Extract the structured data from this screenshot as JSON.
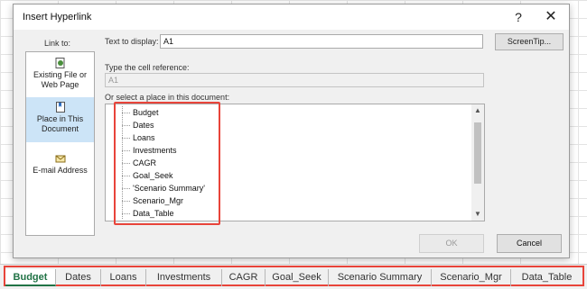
{
  "dialog": {
    "title": "Insert Hyperlink",
    "help": "?",
    "close": "✕",
    "link_to_label": "Link to:",
    "link_to_items": [
      {
        "label": "Existing File or Web Page",
        "selected": false
      },
      {
        "label": "Place in This Document",
        "selected": true
      },
      {
        "label": "E-mail Address",
        "selected": false
      }
    ],
    "text_to_display_label": "Text to display:",
    "text_to_display_value": "A1",
    "screentip_label": "ScreenTip...",
    "cell_reference_label": "Type the cell reference:",
    "cell_reference_value": "A1",
    "place_label": "Or select a place in this document:",
    "places": [
      "Budget",
      "Dates",
      "Loans",
      "Investments",
      "CAGR",
      "Goal_Seek",
      "'Scenario Summary'",
      "Scenario_Mgr",
      "Data_Table"
    ],
    "ok_label": "OK",
    "cancel_label": "Cancel"
  },
  "sheet_tabs": [
    "Budget",
    "Dates",
    "Loans",
    "Investments",
    "CAGR",
    "Goal_Seek",
    "Scenario Summary",
    "Scenario_Mgr",
    "Data_Table"
  ],
  "active_tab": "Budget",
  "colors": {
    "highlight": "#e8443a",
    "excel_green": "#217346",
    "selection": "#cce4f7"
  }
}
